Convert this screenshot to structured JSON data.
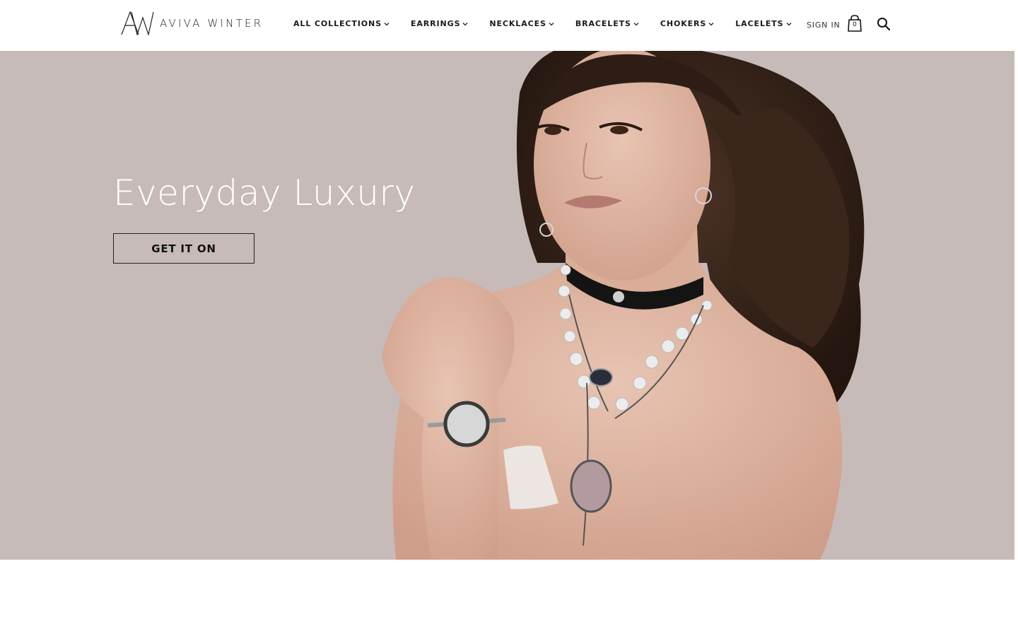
{
  "brand": {
    "name": "AVIVA WINTER",
    "monogram": "AW"
  },
  "nav": {
    "items": [
      {
        "label": "ALL COLLECTIONS"
      },
      {
        "label": "EARRINGS"
      },
      {
        "label": "NECKLACES"
      },
      {
        "label": "BRACELETS"
      },
      {
        "label": "CHOKERS"
      },
      {
        "label": "LACELETS"
      }
    ],
    "chevron_icon": "chevron-down-icon"
  },
  "account": {
    "sign_in_label": "SIGN IN"
  },
  "cart": {
    "icon": "shopping-bag-icon",
    "count": "0"
  },
  "search": {
    "icon": "search-icon"
  },
  "hero": {
    "title": "Everyday Luxury",
    "cta_label": "GET IT ON",
    "background_color": "#c6bbb9"
  }
}
